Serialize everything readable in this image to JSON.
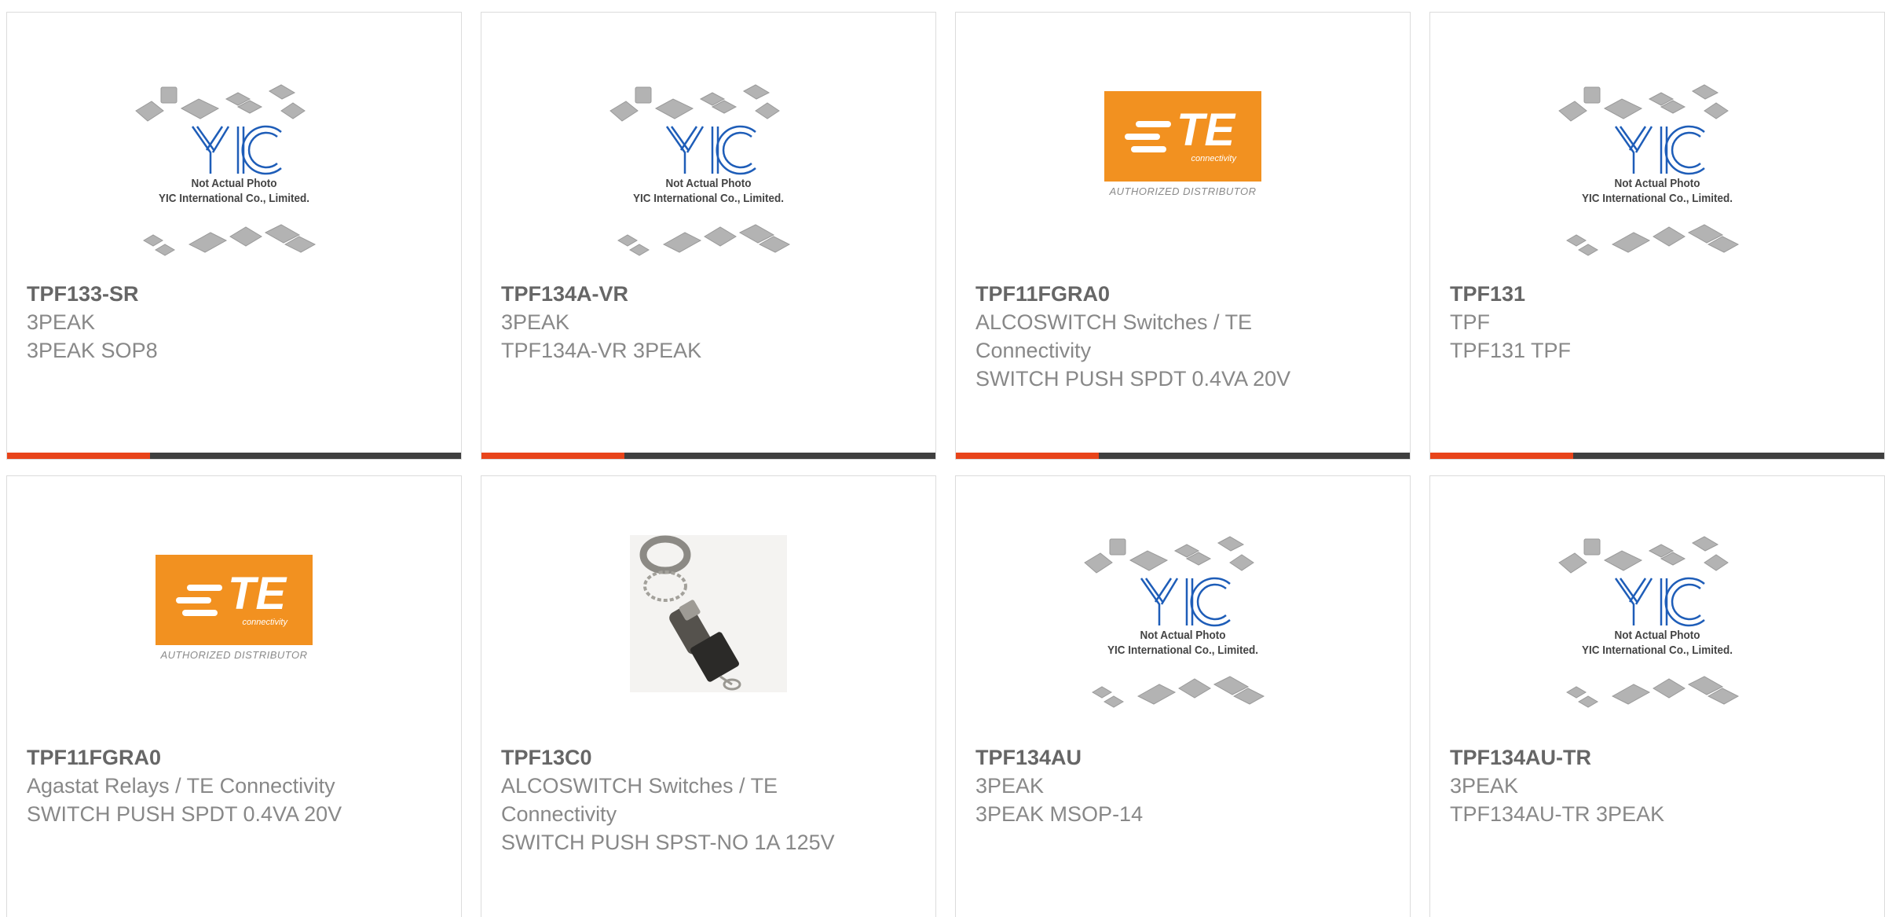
{
  "yic_caption": {
    "line1": "Not Actual Photo",
    "line2": "YIC International Co., Limited."
  },
  "te_logo": {
    "mark": "TE",
    "sub": "connectivity",
    "tagline": "AUTHORIZED DISTRIBUTOR",
    "color": "#f29120"
  },
  "colors": {
    "accent": "#e8441a",
    "bar": "#3f3f3f",
    "title": "#666666",
    "text": "#888888"
  },
  "products": [
    {
      "part_number": "TPF133-SR",
      "manufacturer": "3PEAK",
      "description": "3PEAK SOP8",
      "image": "yic-placeholder"
    },
    {
      "part_number": "TPF134A-VR",
      "manufacturer": "3PEAK",
      "description": "TPF134A-VR 3PEAK",
      "image": "yic-placeholder"
    },
    {
      "part_number": "TPF11FGRA0",
      "manufacturer": "ALCOSWITCH Switches / TE Connectivity",
      "description": "SWITCH PUSH SPDT 0.4VA 20V",
      "image": "te-logo"
    },
    {
      "part_number": "TPF131",
      "manufacturer": "TPF",
      "description": "TPF131 TPF",
      "image": "yic-placeholder"
    },
    {
      "part_number": "TPF11FGRA0",
      "manufacturer": "Agastat Relays / TE Connectivity",
      "description": "SWITCH PUSH SPDT 0.4VA 20V",
      "image": "te-logo"
    },
    {
      "part_number": "TPF13C0",
      "manufacturer": "ALCOSWITCH Switches / TE Connectivity",
      "description": "SWITCH PUSH SPST-NO 1A 125V",
      "image": "pushbutton-switch-photo"
    },
    {
      "part_number": "TPF134AU",
      "manufacturer": "3PEAK",
      "description": "3PEAK MSOP-14",
      "image": "yic-placeholder"
    },
    {
      "part_number": "TPF134AU-TR",
      "manufacturer": "3PEAK",
      "description": "TPF134AU-TR 3PEAK",
      "image": "yic-placeholder"
    }
  ]
}
